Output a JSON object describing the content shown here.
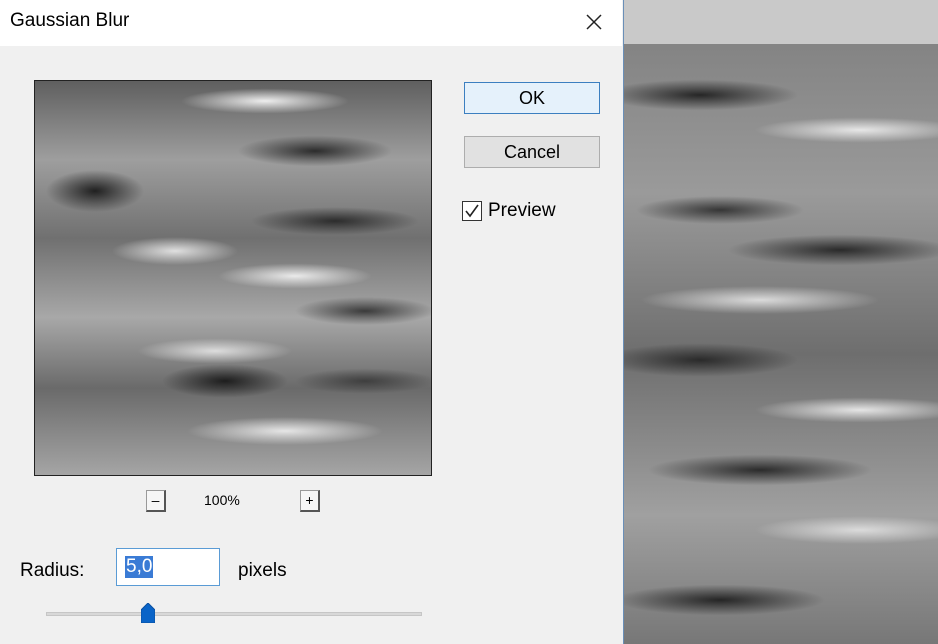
{
  "dialog": {
    "title": "Gaussian Blur",
    "close_label": "✕"
  },
  "buttons": {
    "ok": "OK",
    "cancel": "Cancel"
  },
  "preview": {
    "label": "Preview",
    "checked": true
  },
  "zoom": {
    "minus": "–",
    "plus": "+",
    "level": "100%"
  },
  "radius": {
    "label": "Radius:",
    "value": "5,0",
    "unit": "pixels",
    "slider_fraction": 0.27
  },
  "colors": {
    "accent": "#3a7bd5",
    "ok_border": "#3c7fc0",
    "dialog_bg": "#f0f0f0"
  }
}
